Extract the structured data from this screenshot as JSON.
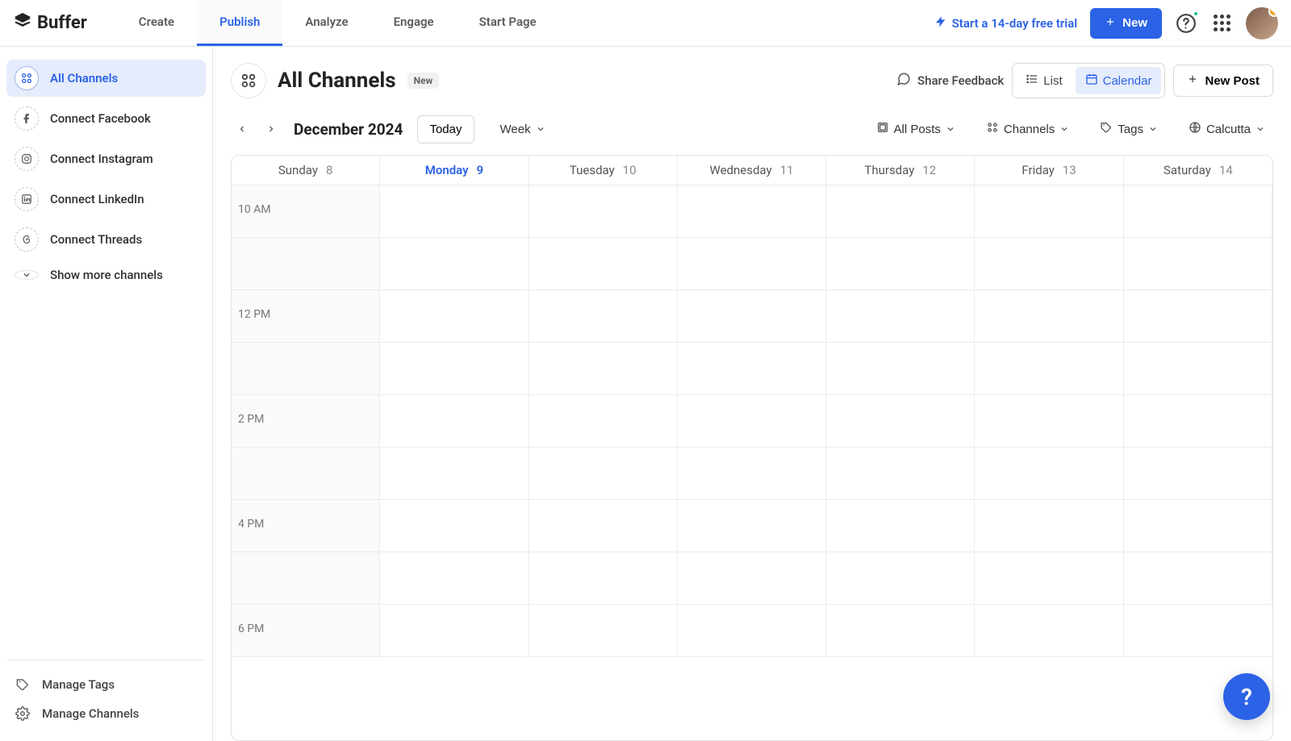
{
  "brand": "Buffer",
  "nav": {
    "tabs": [
      "Create",
      "Publish",
      "Analyze",
      "Engage",
      "Start Page"
    ],
    "activeIndex": 1,
    "trial_text": "Start a 14-day free trial",
    "new_button": "New"
  },
  "sidebar": {
    "all_channels": "All Channels",
    "connect": [
      "Connect Facebook",
      "Connect Instagram",
      "Connect LinkedIn",
      "Connect Threads"
    ],
    "show_more": "Show more channels",
    "manage_tags": "Manage Tags",
    "manage_channels": "Manage Channels"
  },
  "page": {
    "title": "All Channels",
    "badge": "New",
    "share_feedback": "Share Feedback",
    "view_list": "List",
    "view_calendar": "Calendar",
    "new_post": "New Post"
  },
  "toolbar": {
    "month": "December 2024",
    "today": "Today",
    "range": "Week",
    "filters": {
      "posts": "All Posts",
      "channels": "Channels",
      "tags": "Tags",
      "timezone": "Calcutta"
    }
  },
  "calendar": {
    "days": [
      {
        "name": "Sunday",
        "num": "8",
        "today": false
      },
      {
        "name": "Monday",
        "num": "9",
        "today": true
      },
      {
        "name": "Tuesday",
        "num": "10",
        "today": false
      },
      {
        "name": "Wednesday",
        "num": "11",
        "today": false
      },
      {
        "name": "Thursday",
        "num": "12",
        "today": false
      },
      {
        "name": "Friday",
        "num": "13",
        "today": false
      },
      {
        "name": "Saturday",
        "num": "14",
        "today": false
      }
    ],
    "hours": [
      "10 AM",
      "",
      "12 PM",
      "",
      "2 PM",
      "",
      "4 PM",
      "",
      "6 PM"
    ]
  },
  "help_fab": "?"
}
